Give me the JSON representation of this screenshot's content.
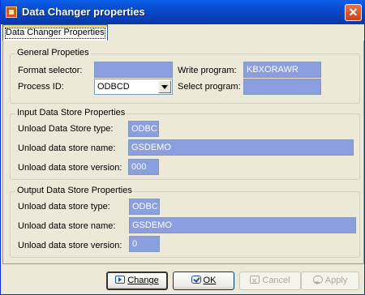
{
  "window": {
    "title": "Data Changer properties",
    "close_glyph": "✕"
  },
  "tabs": [
    {
      "label": "Data Changer Properties",
      "selected": true
    }
  ],
  "general": {
    "title": "General Propeties",
    "format_selector": {
      "label": "Format selector:",
      "value": ""
    },
    "write_program": {
      "label": "Write program:",
      "value": "KBXORAWR"
    },
    "process_id": {
      "label": "Process ID:",
      "value": "ODBCD"
    },
    "select_program": {
      "label": "Select program:",
      "value": ""
    }
  },
  "input_store": {
    "title": "Input Data Store Properties",
    "type": {
      "label": "Unload Data Store type:",
      "value": "ODBC"
    },
    "name": {
      "label": "Unload data store name:",
      "value": "GSDEMO"
    },
    "version": {
      "label": "Unload data store version:",
      "value": "000"
    }
  },
  "output_store": {
    "title": "Output Data Store Properties",
    "type": {
      "label": "Unload data store type:",
      "value": "ODBC"
    },
    "name": {
      "label": "Unload data store name:",
      "value": "GSDEMO"
    },
    "version": {
      "label": "Unload data store version:",
      "value": "0"
    }
  },
  "buttons": {
    "change": {
      "label": "Change",
      "icon": "change-icon",
      "enabled": true
    },
    "ok": {
      "label": "OK",
      "icon": "ok-check-icon",
      "enabled": true
    },
    "cancel": {
      "label": "Cancel",
      "icon": "cancel-icon",
      "enabled": false
    },
    "apply": {
      "label": "Apply",
      "icon": "apply-icon",
      "enabled": false
    }
  },
  "colors": {
    "field_bg": "#8A9EE0",
    "titlebar": "#0848C8",
    "dialog_bg": "#ECE9D8"
  }
}
